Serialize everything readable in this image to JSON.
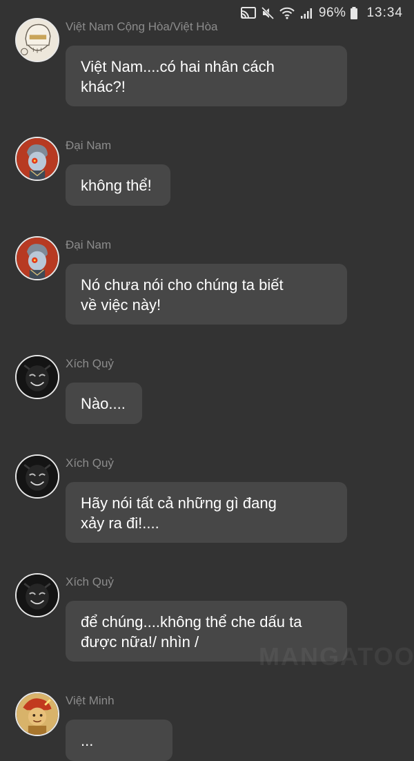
{
  "status_bar": {
    "icons": [
      "cast-icon",
      "mute-icon",
      "wifi-icon",
      "signal-icon",
      "battery-icon"
    ],
    "battery_percent": "96%",
    "time": "13:34"
  },
  "messages": [
    {
      "sender": "Việt Nam Cộng Hòa/Việt Hòa",
      "avatar": "character-avatar-skull",
      "lines": [
        "Việt Nam....có hai nhân cách",
        "khác?!"
      ]
    },
    {
      "sender": "Đại Nam",
      "avatar": "character-avatar-red",
      "lines": [
        "không thể!"
      ]
    },
    {
      "sender": "Đại Nam",
      "avatar": "character-avatar-red",
      "lines": [
        "Nó chưa nói cho chúng ta biết",
        "về việc này!"
      ]
    },
    {
      "sender": "Xích Quỷ",
      "avatar": "character-avatar-dark",
      "lines": [
        "Nào...."
      ]
    },
    {
      "sender": "Xích Quỷ",
      "avatar": "character-avatar-dark",
      "lines": [
        "Hãy nói tất cả những gì đang",
        "xảy ra đi!...."
      ]
    },
    {
      "sender": "Xích Quỷ",
      "avatar": "character-avatar-dark",
      "lines": [
        "để chúng....không thể che dấu ta",
        "được nữa!/ nhìn /"
      ]
    },
    {
      "sender": "Việt Minh",
      "avatar": "character-avatar-yellow",
      "lines": [
        "..."
      ]
    }
  ],
  "watermark": "MANGATOON",
  "colors": {
    "background": "#333333",
    "bubble": "#474747",
    "sender_text": "#8c8c8c",
    "message_text": "#ffffff"
  }
}
